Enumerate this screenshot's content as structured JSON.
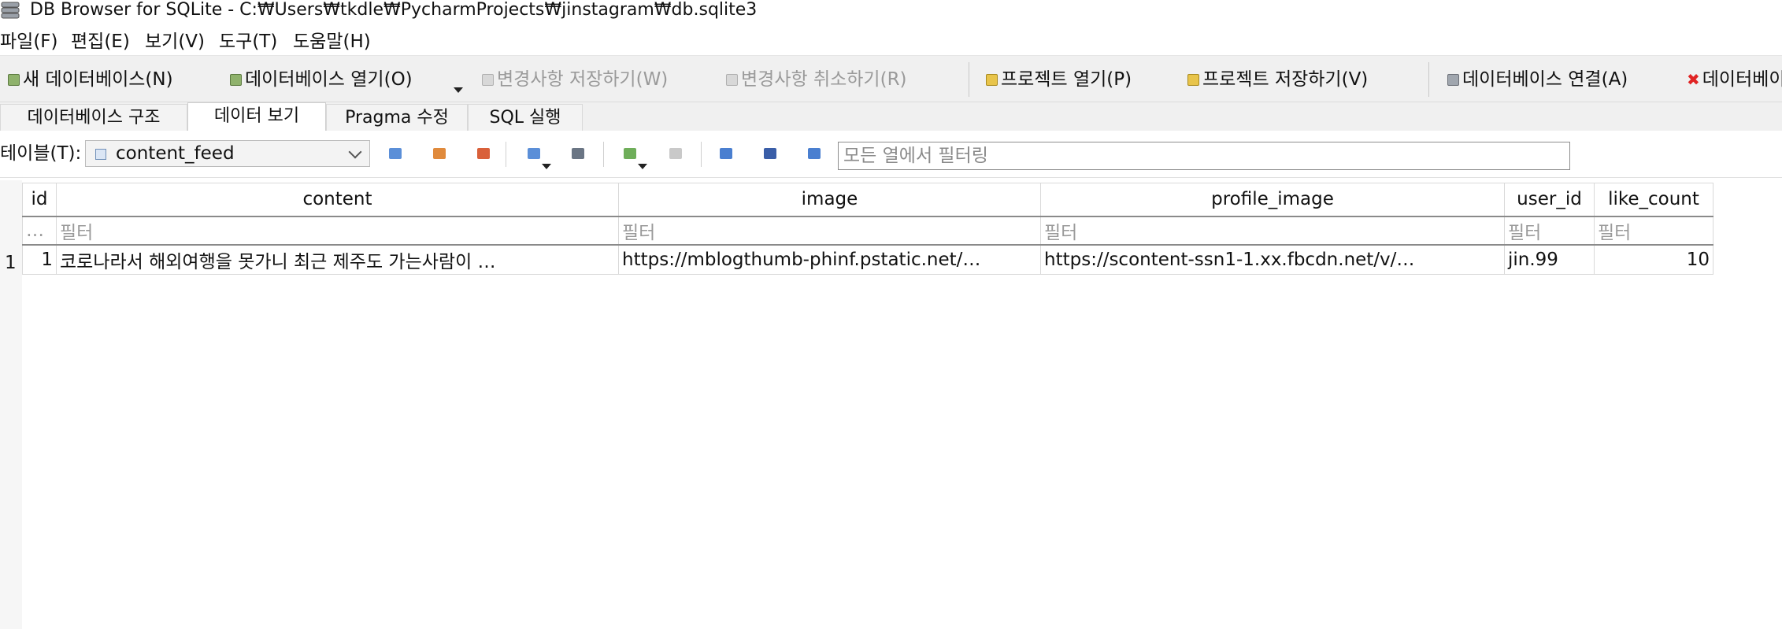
{
  "window": {
    "title": "DB Browser for SQLite - C:₩Users₩tkdle₩PycharmProjects₩jinstagram₩db.sqlite3"
  },
  "menu": [
    "파일(F)",
    "편집(E)",
    "보기(V)",
    "도구(T)",
    "도움말(H)"
  ],
  "toolbar": {
    "new_db": "새 데이터베이스(N)",
    "open_db": "데이터베이스 열기(O)",
    "write_changes": "변경사항 저장하기(W)",
    "revert_changes": "변경사항 취소하기(R)",
    "open_project": "프로젝트 열기(P)",
    "save_project": "프로젝트 저장하기(V)",
    "attach_db": "데이터베이스 연결(A)",
    "close_db": "데이터베이"
  },
  "tabs": [
    "데이터베이스 구조",
    "데이터 보기",
    "Pragma 수정",
    "SQL 실행"
  ],
  "browse": {
    "table_label": "테이블(T):",
    "table_value": "content_feed",
    "filter_placeholder": "모든 열에서 필터링"
  },
  "grid": {
    "columns": [
      "id",
      "content",
      "image",
      "profile_image",
      "user_id",
      "like_count"
    ],
    "filter_placeholders": [
      "…",
      "필터",
      "필터",
      "필터",
      "필터",
      "필터"
    ],
    "rows": [
      {
        "row_number": "1",
        "cells": [
          "1",
          "코로나라서 해외여행을 못가니 최근 제주도 가는사람이 …",
          "https://mblogthumb-phinf.pstatic.net/…",
          "https://scontent-ssn1-1.xx.fbcdn.net/v/…",
          "jin.99",
          "10"
        ]
      }
    ]
  },
  "icons": {
    "app": "database-stack-icon",
    "close": "red-x-icon"
  },
  "colors": {
    "toolbar_bg": "#f0f0f0",
    "disabled_text": "#9a9a9a",
    "close_red": "#e02424"
  }
}
